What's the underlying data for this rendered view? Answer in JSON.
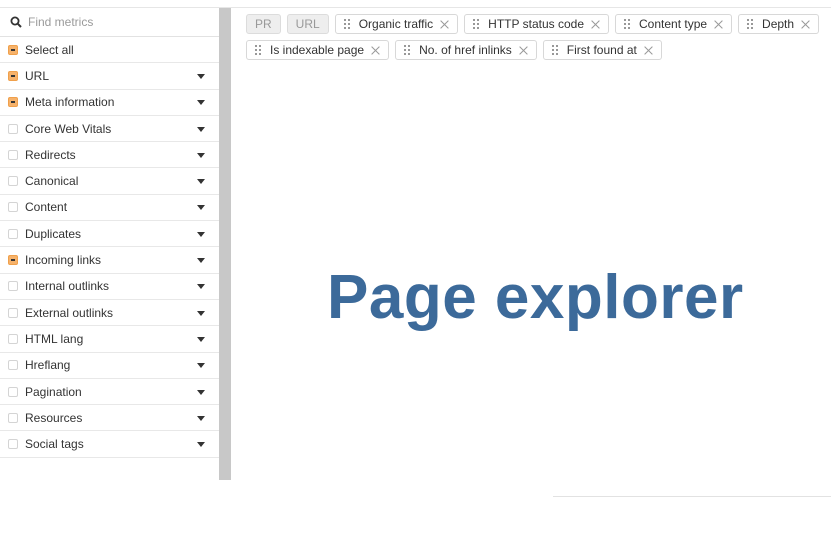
{
  "search": {
    "placeholder": "Find metrics",
    "value": ""
  },
  "sidebar": {
    "select_all": {
      "label": "Select all",
      "state": "partial"
    },
    "items": [
      {
        "label": "URL",
        "state": "partial"
      },
      {
        "label": "Meta information",
        "state": "partial"
      },
      {
        "label": "Core Web Vitals",
        "state": "unchecked"
      },
      {
        "label": "Redirects",
        "state": "unchecked"
      },
      {
        "label": "Canonical",
        "state": "unchecked"
      },
      {
        "label": "Content",
        "state": "unchecked"
      },
      {
        "label": "Duplicates",
        "state": "unchecked"
      },
      {
        "label": "Incoming links",
        "state": "partial"
      },
      {
        "label": "Internal outlinks",
        "state": "unchecked"
      },
      {
        "label": "External outlinks",
        "state": "unchecked"
      },
      {
        "label": "HTML lang",
        "state": "unchecked"
      },
      {
        "label": "Hreflang",
        "state": "unchecked"
      },
      {
        "label": "Pagination",
        "state": "unchecked"
      },
      {
        "label": "Resources",
        "state": "unchecked"
      },
      {
        "label": "Social tags",
        "state": "unchecked"
      }
    ]
  },
  "columns": {
    "fixed": [
      "PR",
      "URL"
    ],
    "row1": [
      "Organic traffic",
      "HTTP status code",
      "Content type",
      "Depth"
    ],
    "row2": [
      "Is indexable page",
      "No. of href inlinks",
      "First found at"
    ]
  },
  "headline": "Page explorer",
  "colors": {
    "partial_checkbox": "#f6b26b",
    "headline": "#3c6a9a"
  }
}
